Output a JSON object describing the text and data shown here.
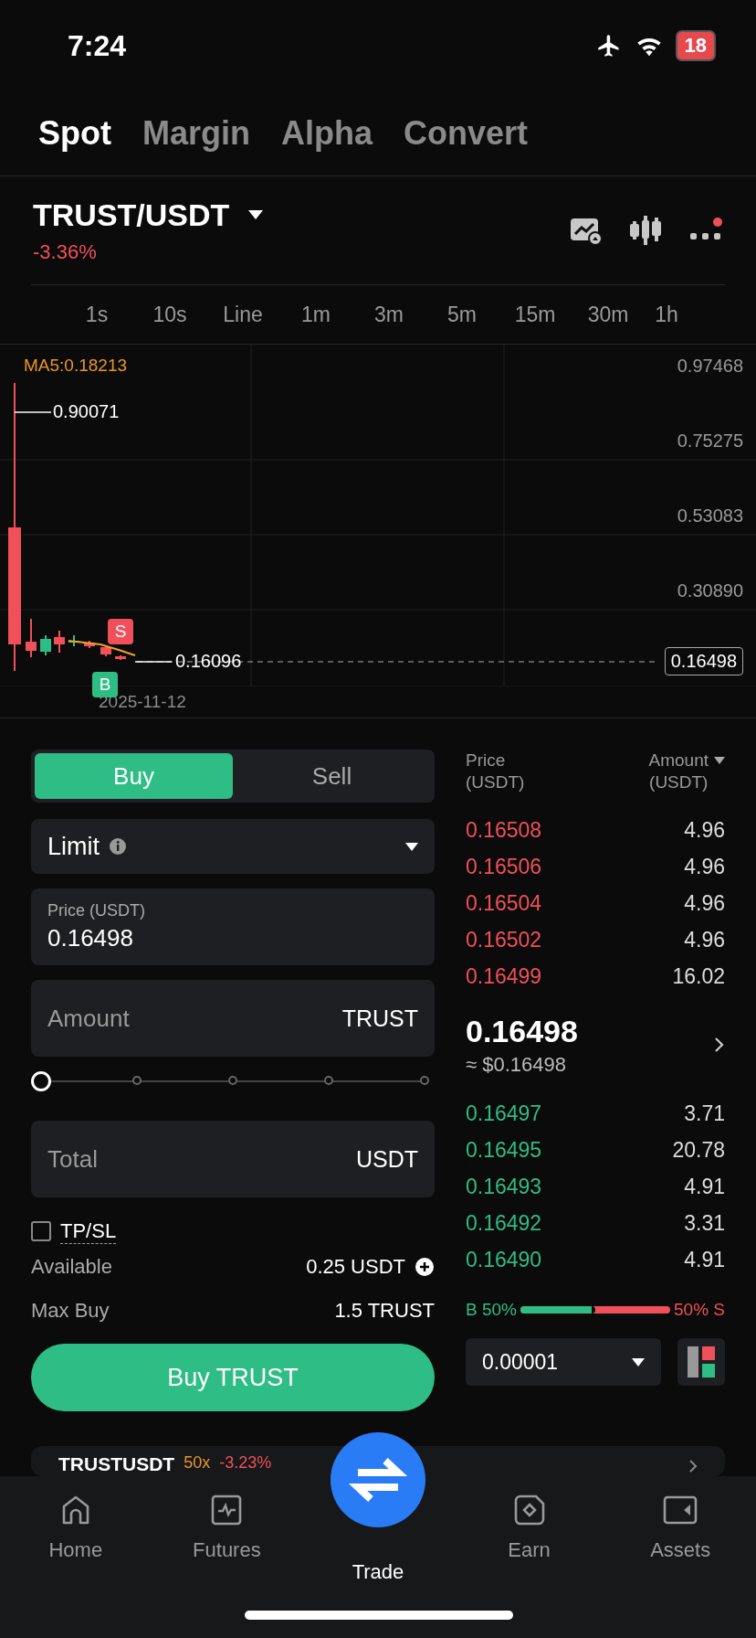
{
  "status_bar": {
    "time": "7:24",
    "battery": "18"
  },
  "market_tabs": [
    {
      "label": "Spot",
      "selected": true
    },
    {
      "label": "Margin",
      "selected": false
    },
    {
      "label": "Alpha",
      "selected": false
    },
    {
      "label": "Convert",
      "selected": false
    }
  ],
  "pair": {
    "name": "TRUST/USDT",
    "change": "-3.36%"
  },
  "intervals": [
    {
      "label": "1s",
      "selected": false
    },
    {
      "label": "10s",
      "selected": false
    },
    {
      "label": "Line",
      "selected": false
    },
    {
      "label": "1m",
      "selected": false
    },
    {
      "label": "3m",
      "selected": false
    },
    {
      "label": "5m",
      "selected": false
    },
    {
      "label": "15m",
      "selected": false
    },
    {
      "label": "30m",
      "selected": false
    },
    {
      "label": "1h",
      "selected": false
    }
  ],
  "chart": {
    "ma_label": "MA5:0.18213",
    "y_labels": [
      "0.97468",
      "0.75275",
      "0.53083",
      "0.30890"
    ],
    "high_label": "0.90071",
    "low_label": "0.16096",
    "last_price_tag": "0.16498",
    "date_label": "2025-11-12",
    "sell_marker": "S",
    "buy_marker": "B"
  },
  "order_form": {
    "sides": [
      {
        "label": "Buy",
        "selected": true
      },
      {
        "label": "Sell",
        "selected": false
      }
    ],
    "order_type": "Limit",
    "price_label": "Price (USDT)",
    "price_value": "0.16498",
    "amount_placeholder": "Amount",
    "amount_unit": "TRUST",
    "slider": {
      "level": 0
    },
    "total_placeholder": "Total",
    "total_unit": "USDT",
    "tpsl": {
      "label": "TP/SL",
      "checked": false
    },
    "available_label": "Available",
    "available_value": "0.25 USDT",
    "max_buy_label": "Max Buy",
    "max_buy_value": "1.5 TRUST",
    "submit": "Buy TRUST"
  },
  "order_book": {
    "price_header": "Price\n(USDT)",
    "amount_header": "Amount\n(USDT)",
    "asks": [
      {
        "price": "0.16508",
        "amount": "4.96"
      },
      {
        "price": "0.16506",
        "amount": "4.96"
      },
      {
        "price": "0.16504",
        "amount": "4.96"
      },
      {
        "price": "0.16502",
        "amount": "4.96"
      },
      {
        "price": "0.16499",
        "amount": "16.02"
      }
    ],
    "last_price": "0.16498",
    "last_price_usd": "≈ $0.16498",
    "bids": [
      {
        "price": "0.16497",
        "amount": "3.71"
      },
      {
        "price": "0.16495",
        "amount": "20.78"
      },
      {
        "price": "0.16493",
        "amount": "4.91"
      },
      {
        "price": "0.16492",
        "amount": "3.31"
      },
      {
        "price": "0.16490",
        "amount": "4.91"
      }
    ],
    "buy_ratio_label": "B 50%",
    "sell_ratio_label": "50% S",
    "buy_ratio": {
      "level": 0.5
    },
    "precision": "0.00001"
  },
  "futures_card": {
    "symbol": "TRUSTUSDT",
    "leverage": "50x",
    "change": "-3.23%"
  },
  "nav": [
    {
      "label": "Home",
      "selected": false
    },
    {
      "label": "Futures",
      "selected": false
    },
    {
      "label": "Trade",
      "selected": true
    },
    {
      "label": "Earn",
      "selected": false
    },
    {
      "label": "Assets",
      "selected": false
    }
  ]
}
